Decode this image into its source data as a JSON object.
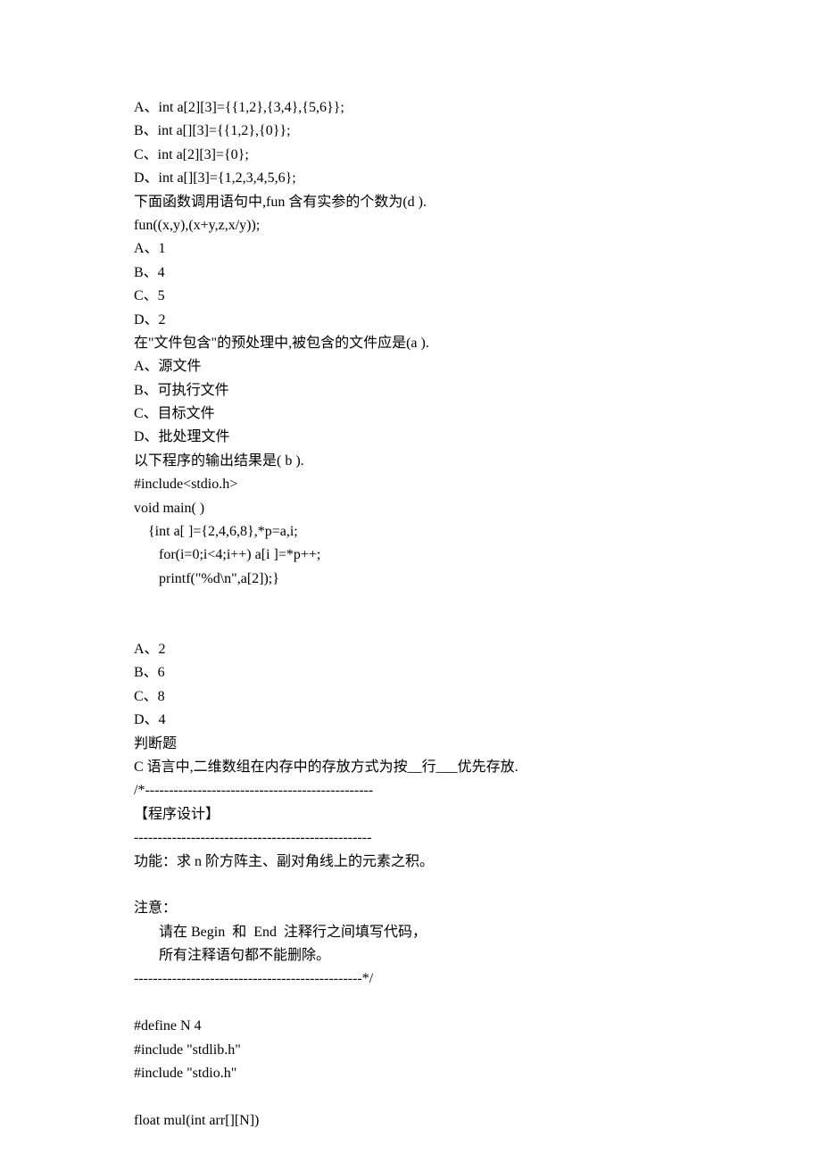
{
  "lines": [
    "A、int a[2][3]={{1,2},{3,4},{5,6}};",
    "B、int a[][3]={{1,2},{0}};",
    "C、int a[2][3]={0};",
    "D、int a[][3]={1,2,3,4,5,6};",
    "下面函数调用语句中,fun 含有实参的个数为(d ).",
    "fun((x,y),(x+y,z,x/y));",
    "A、1",
    "B、4",
    "C、5",
    "D、2",
    "在\"文件包含\"的预处理中,被包含的文件应是(a ).",
    "A、源文件",
    "B、可执行文件",
    "C、目标文件",
    "D、批处理文件",
    "以下程序的输出结果是( b ).",
    "#include<stdio.h>",
    "void main( )",
    "    {int a[ ]={2,4,6,8},*p=a,i;",
    "       for(i=0;i<4;i++) a[i ]=*p++;",
    "       printf(\"%d\\n\",a[2]);}",
    "",
    "",
    "A、2",
    "B、6",
    "C、8",
    "D、4",
    "判断题",
    "C 语言中,二维数组在内存中的存放方式为按__行___优先存放.",
    "/*------------------------------------------------",
    "【程序设计】",
    "--------------------------------------------------",
    "功能：求 n 阶方阵主、副对角线上的元素之积。",
    "",
    "注意：",
    "       请在 Begin  和  End  注释行之间填写代码，",
    "       所有注释语句都不能删除。",
    "------------------------------------------------*/",
    "",
    "#define N 4",
    "#include \"stdlib.h\"",
    "#include \"stdio.h\"",
    "",
    "float mul(int arr[][N])"
  ]
}
